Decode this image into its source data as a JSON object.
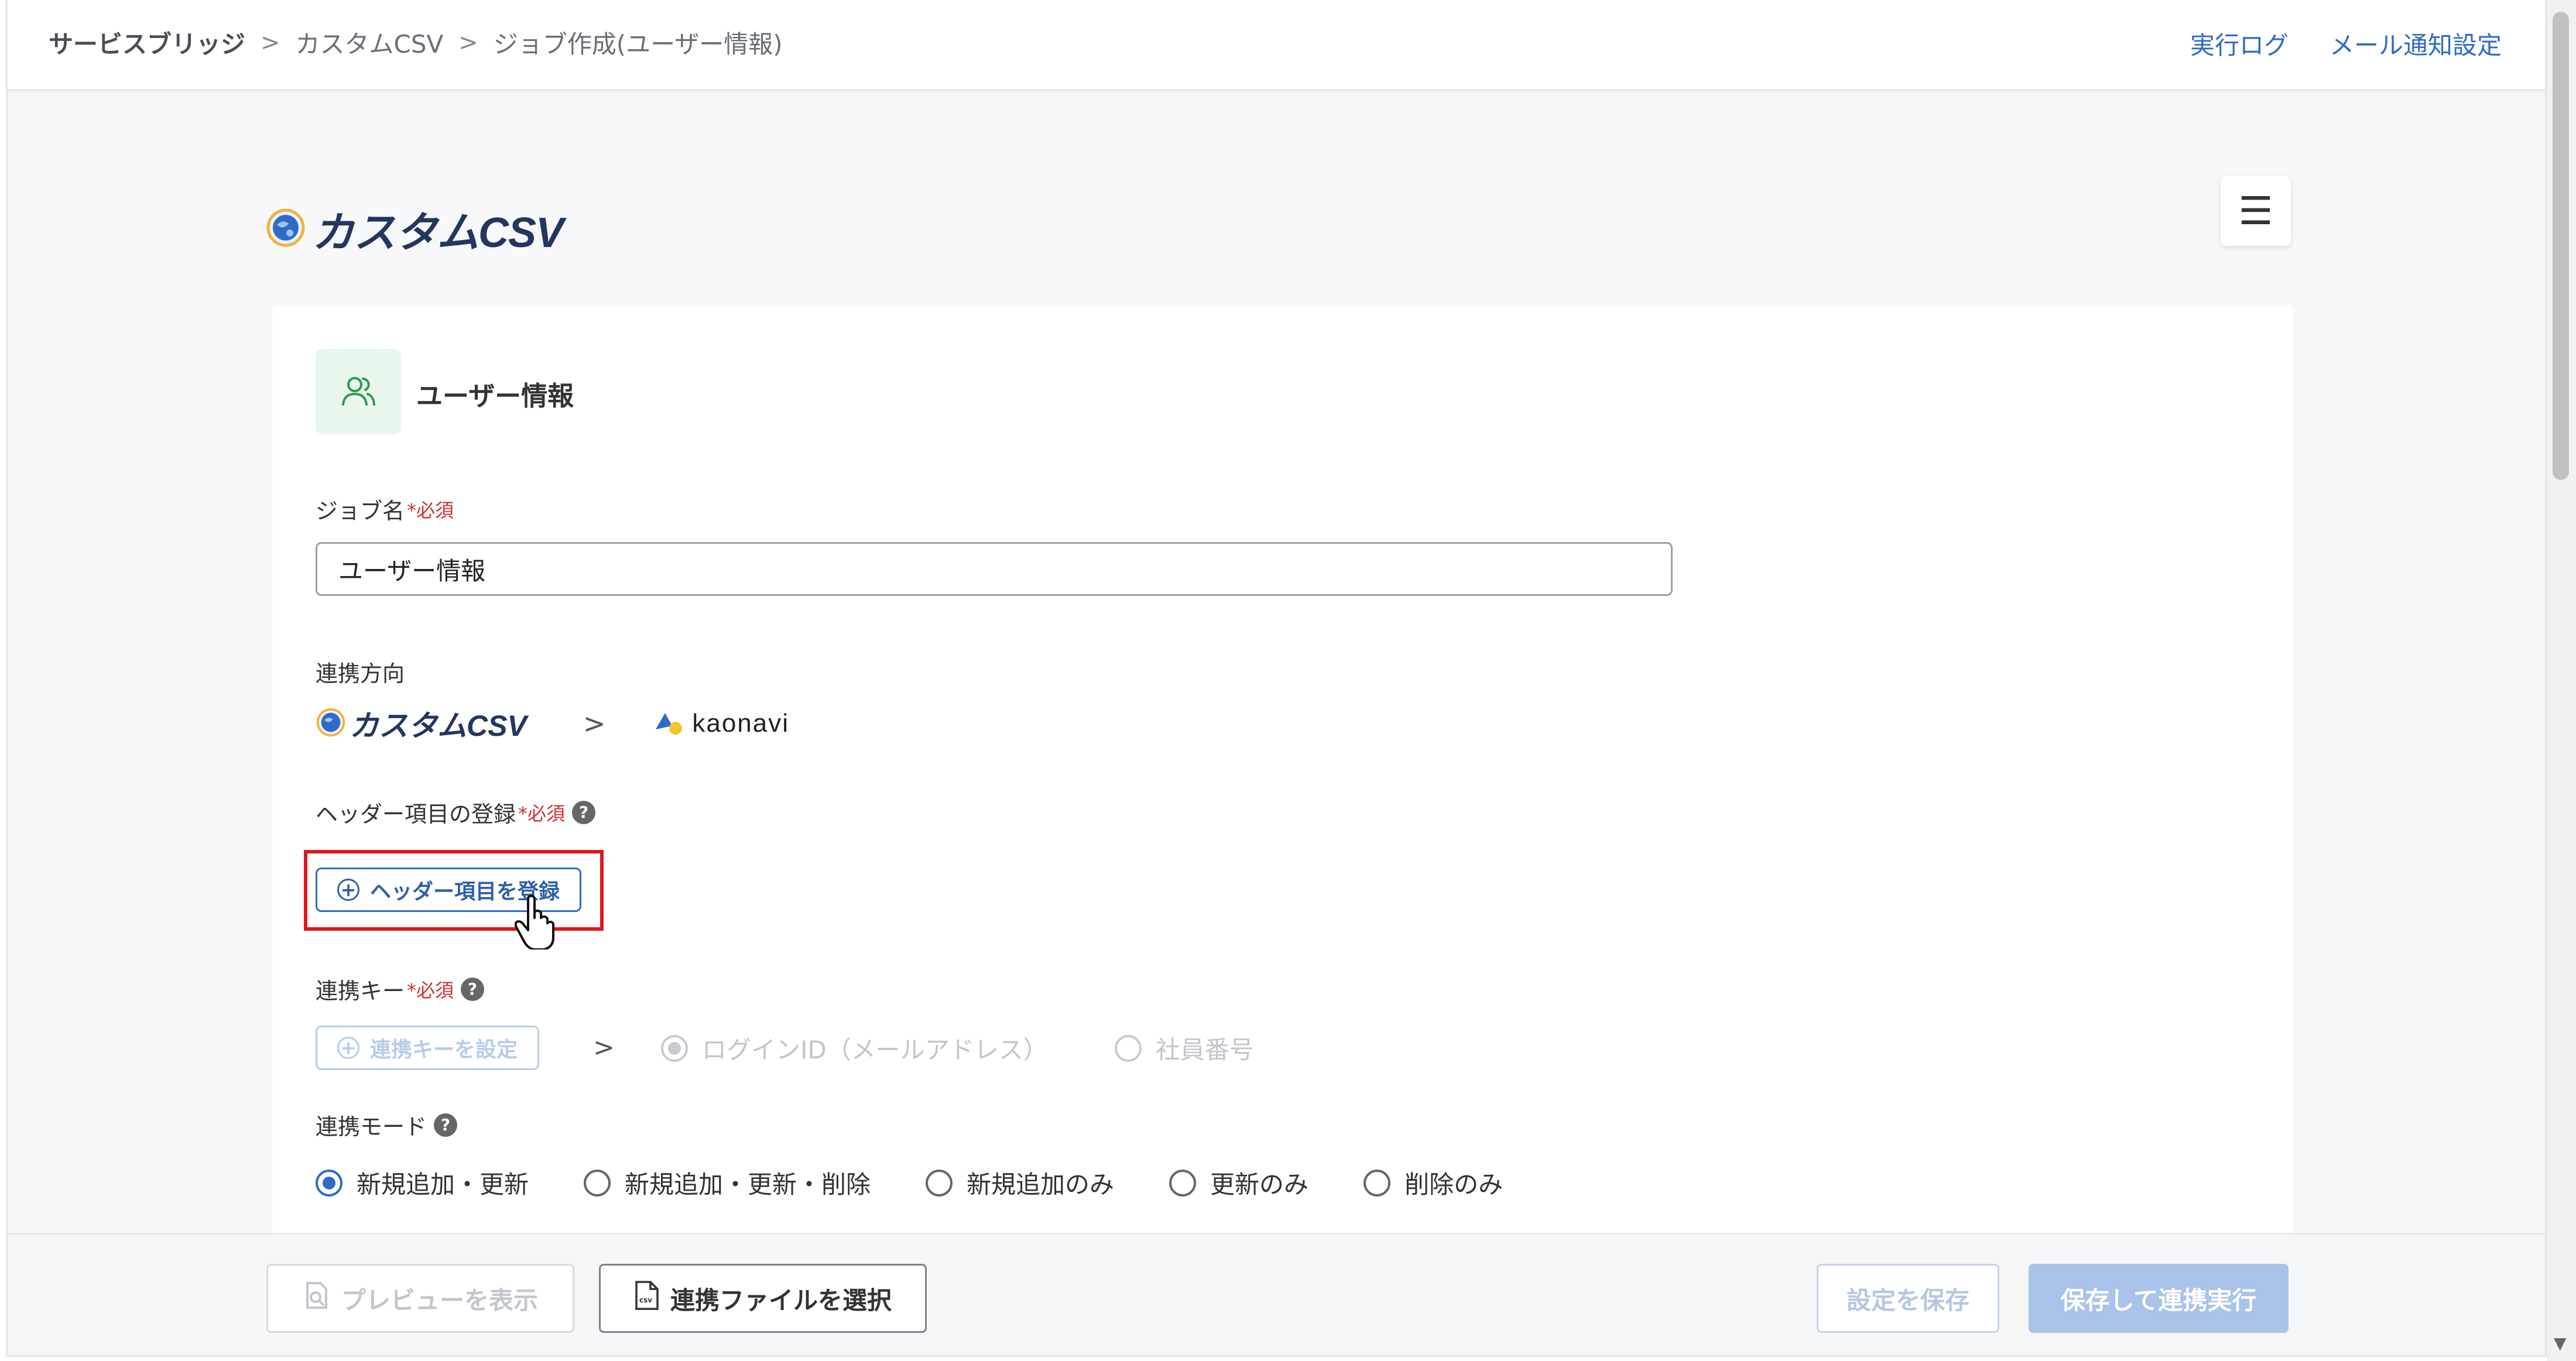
{
  "breadcrumb": {
    "root": "サービスブリッジ",
    "item1": "カスタムCSV",
    "current": "ジョブ作成(ユーザー情報)",
    "separator": ">"
  },
  "topnav": {
    "log": "実行ログ",
    "mail": "メール通知設定"
  },
  "brand": {
    "name": "カスタムCSV"
  },
  "menu_icon": "☰",
  "section": {
    "title": "ユーザー情報",
    "icon": "users-icon"
  },
  "job_name": {
    "label": "ジョブ名",
    "required": "*必須",
    "value": "ユーザー情報"
  },
  "direction": {
    "label": "連携方向",
    "from": "カスタムCSV",
    "to": "kaonavi",
    "chevron": ">"
  },
  "header_items": {
    "label": "ヘッダー項目の登録",
    "required": "*必須",
    "help": "?",
    "button": "ヘッダー項目を登録",
    "plus": "+"
  },
  "link_key": {
    "label": "連携キー",
    "required": "*必須",
    "help": "?",
    "button": "連携キーを設定",
    "chevron": ">",
    "options": [
      "ログインID（メールアドレス）",
      "社員番号"
    ],
    "selected": 0
  },
  "mode": {
    "label": "連携モード",
    "help": "?",
    "options": [
      "新規追加・更新",
      "新規追加・更新・削除",
      "新規追加のみ",
      "更新のみ",
      "削除のみ"
    ],
    "selected": 0
  },
  "footer": {
    "preview": "プレビューを表示",
    "select_file": "連携ファイルを選択",
    "save": "設定を保存",
    "save_run": "保存して連携実行"
  },
  "colors": {
    "accent": "#2f6bc5",
    "required": "#d32f2f",
    "highlight": "#e0161a",
    "brand": "#24355f"
  }
}
